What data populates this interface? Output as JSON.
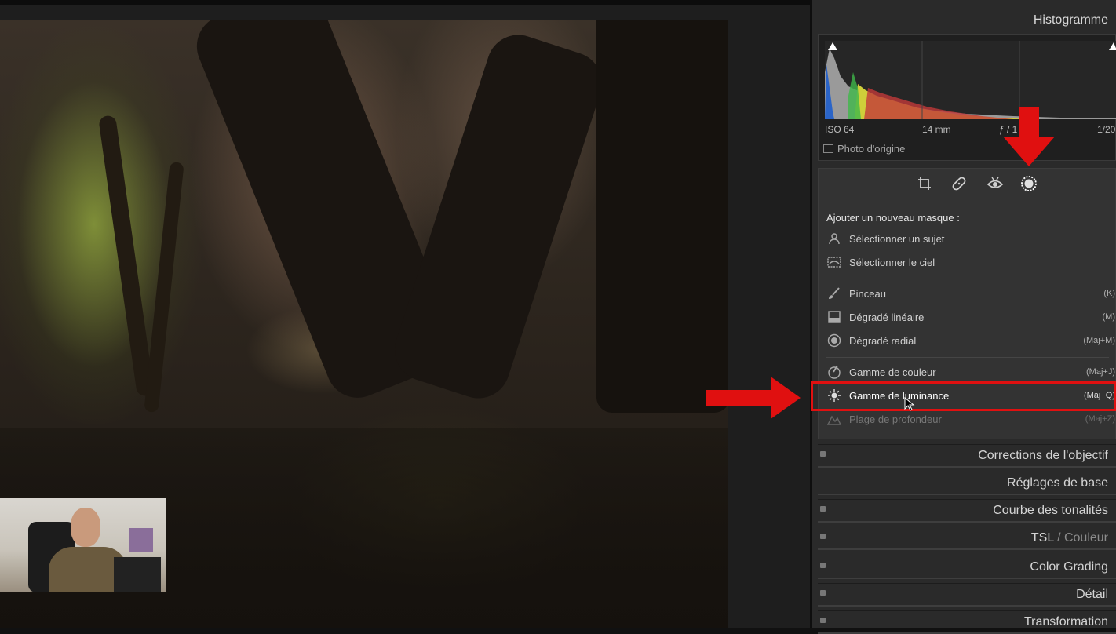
{
  "panel": {
    "histogram_title": "Histogramme",
    "exif": {
      "iso": "ISO 64",
      "focal": "14 mm",
      "aperture": "ƒ / 1",
      "shutter": "1/20"
    },
    "photo_origin": "Photo d'origine",
    "mask": {
      "title": "Ajouter un nouveau masque :",
      "items": [
        {
          "label": "Sélectionner un sujet",
          "shortcut": "",
          "icon": "person-icon"
        },
        {
          "label": "Sélectionner le ciel",
          "shortcut": "",
          "icon": "sky-icon"
        },
        {
          "label": "Pinceau",
          "shortcut": "(K)",
          "icon": "brush-icon"
        },
        {
          "label": "Dégradé linéaire",
          "shortcut": "(M)",
          "icon": "linear-gradient-icon"
        },
        {
          "label": "Dégradé radial",
          "shortcut": "(Maj+M)",
          "icon": "radial-gradient-icon"
        },
        {
          "label": "Gamme de couleur",
          "shortcut": "(Maj+J)",
          "icon": "color-range-icon"
        },
        {
          "label": "Gamme de luminance",
          "shortcut": "(Maj+Q)",
          "icon": "luminance-range-icon"
        },
        {
          "label": "Plage de profondeur",
          "shortcut": "(Maj+Z)",
          "icon": "depth-range-icon"
        }
      ]
    },
    "sections": [
      {
        "title": "Corrections de l'objectif"
      },
      {
        "title": "Réglages de base"
      },
      {
        "title": "Courbe des tonalités"
      },
      {
        "title_main": "TSL",
        "title_sep": " / ",
        "title_muted": "Couleur"
      },
      {
        "title": "Color Grading"
      },
      {
        "title": "Détail"
      },
      {
        "title": "Transformation"
      }
    ]
  },
  "colors": {
    "panel_bg": "#2a2a2a",
    "highlight": "#e01010",
    "photo_bg": "#1e1e1e"
  }
}
